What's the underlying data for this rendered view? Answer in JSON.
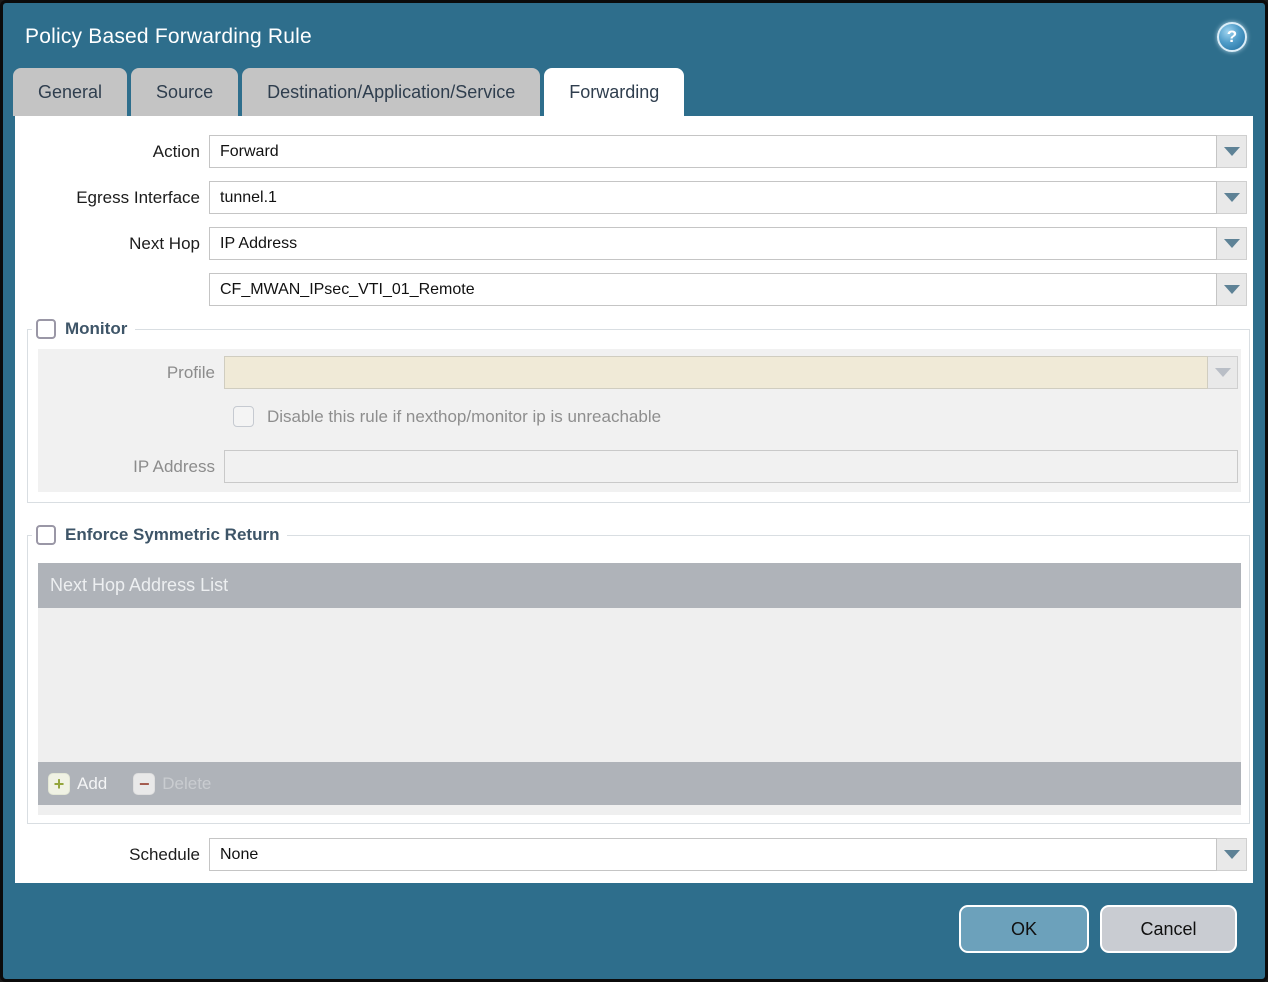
{
  "dialog": {
    "title": "Policy Based Forwarding Rule",
    "help_glyph": "?"
  },
  "tabs": [
    {
      "label": "General",
      "active": false
    },
    {
      "label": "Source",
      "active": false
    },
    {
      "label": "Destination/Application/Service",
      "active": false
    },
    {
      "label": "Forwarding",
      "active": true
    }
  ],
  "form": {
    "action": {
      "label": "Action",
      "value": "Forward"
    },
    "egress_interface": {
      "label": "Egress Interface",
      "value": "tunnel.1"
    },
    "next_hop": {
      "label": "Next Hop",
      "value": "IP Address"
    },
    "next_hop_address": {
      "label": "",
      "value": "CF_MWAN_IPsec_VTI_01_Remote"
    },
    "schedule": {
      "label": "Schedule",
      "value": "None"
    }
  },
  "monitor": {
    "legend": "Monitor",
    "checked": false,
    "profile": {
      "label": "Profile",
      "value": ""
    },
    "disable_rule_checkbox": {
      "label": "Disable this rule if nexthop/monitor ip is unreachable",
      "checked": false
    },
    "ip_address": {
      "label": "IP Address",
      "value": ""
    }
  },
  "enforce_symmetric_return": {
    "legend": "Enforce Symmetric Return",
    "checked": false,
    "table": {
      "header": "Next Hop Address List",
      "rows": []
    },
    "add_label": "Add",
    "delete_label": "Delete",
    "plus_glyph": "+",
    "minus_glyph": "−"
  },
  "footer": {
    "ok_label": "OK",
    "cancel_label": "Cancel"
  },
  "colors": {
    "titlebar_teal": "#2E6E8C",
    "active_tab": "#FFFFFF",
    "inactive_tab": "#C4C4C4",
    "disabled_field_beige": "#F0EAD7",
    "panel_gray": "#F1F1F1",
    "table_header_gray": "#AFB3B9",
    "ok_button": "#6CA1BB",
    "cancel_button": "#C9CCD2",
    "dropdown_arrow": "#5E8296",
    "add_plus_green": "#94A63C",
    "delete_minus_red": "#A35A4E"
  }
}
